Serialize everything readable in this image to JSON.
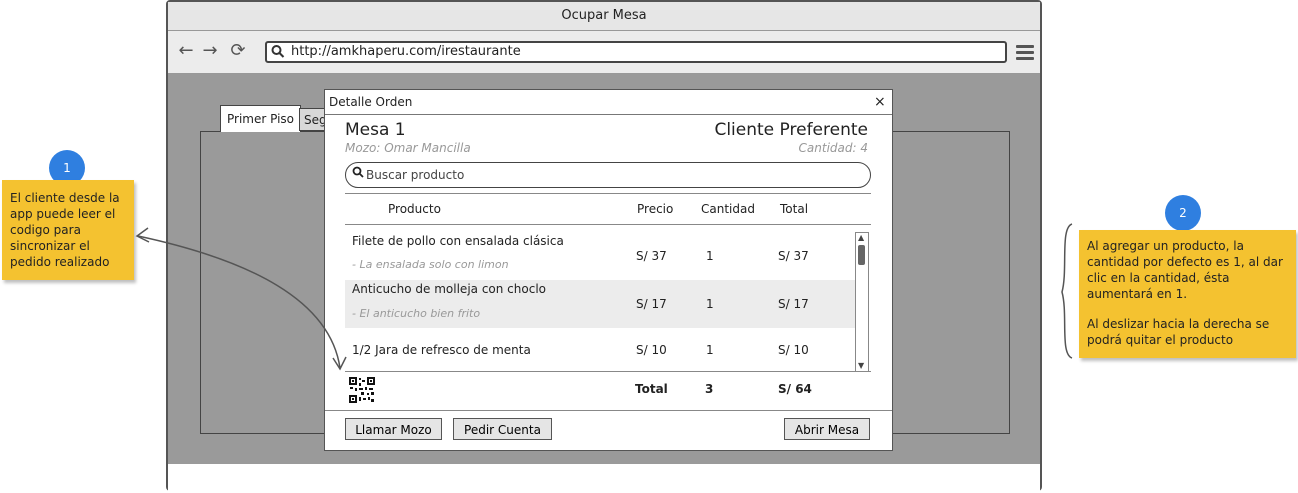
{
  "browser": {
    "title": "Ocupar Mesa",
    "url": "http://amkhaperu.com/irestaurante",
    "nav": {
      "back": "←",
      "forward": "→",
      "reload": "⟳"
    }
  },
  "background_tabs": [
    "Primer Piso",
    "Seg"
  ],
  "dialog": {
    "title": "Detalle Orden",
    "close": "×",
    "mesa": "Mesa 1",
    "mozo": "Mozo: Omar Mancilla",
    "cliente": "Cliente Preferente",
    "cantidad": "Cantidad: 4",
    "search_placeholder": "Buscar producto",
    "columns": {
      "producto": "Producto",
      "precio": "Precio",
      "cantidad": "Cantidad",
      "total": "Total"
    },
    "items": [
      {
        "name": "Filete de pollo con ensalada clásica",
        "note": "- La ensalada solo con limon",
        "price": "S/ 37",
        "qty": "1",
        "total": "S/ 37"
      },
      {
        "name": "Anticucho de molleja con choclo",
        "note": "- El anticucho bien frito",
        "price": "S/ 17",
        "qty": "1",
        "total": "S/ 17"
      },
      {
        "name": "1/2 Jara de refresco de menta",
        "note": "",
        "price": "S/ 10",
        "qty": "1",
        "total": "S/ 10"
      }
    ],
    "totals": {
      "label": "Total",
      "qty": "3",
      "amount": "S/ 64"
    },
    "buttons": {
      "llamar_mozo": "Llamar Mozo",
      "pedir_cuenta": "Pedir Cuenta",
      "abrir_mesa": "Abrir Mesa"
    }
  },
  "annotations": {
    "one": {
      "number": "1",
      "text": "El cliente desde la app puede leer el codigo para sincronizar el pedido realizado"
    },
    "two": {
      "number": "2",
      "text1": "Al agregar un producto, la cantidad por defecto es 1, al dar clic en la cantidad, ésta aumentará en 1.",
      "text2": "Al deslizar hacia la derecha se podrá quitar el producto"
    }
  },
  "colors": {
    "bubble": "#2f7fe0",
    "sticky": "#f4c230",
    "canvas": "#9a9a9a"
  }
}
